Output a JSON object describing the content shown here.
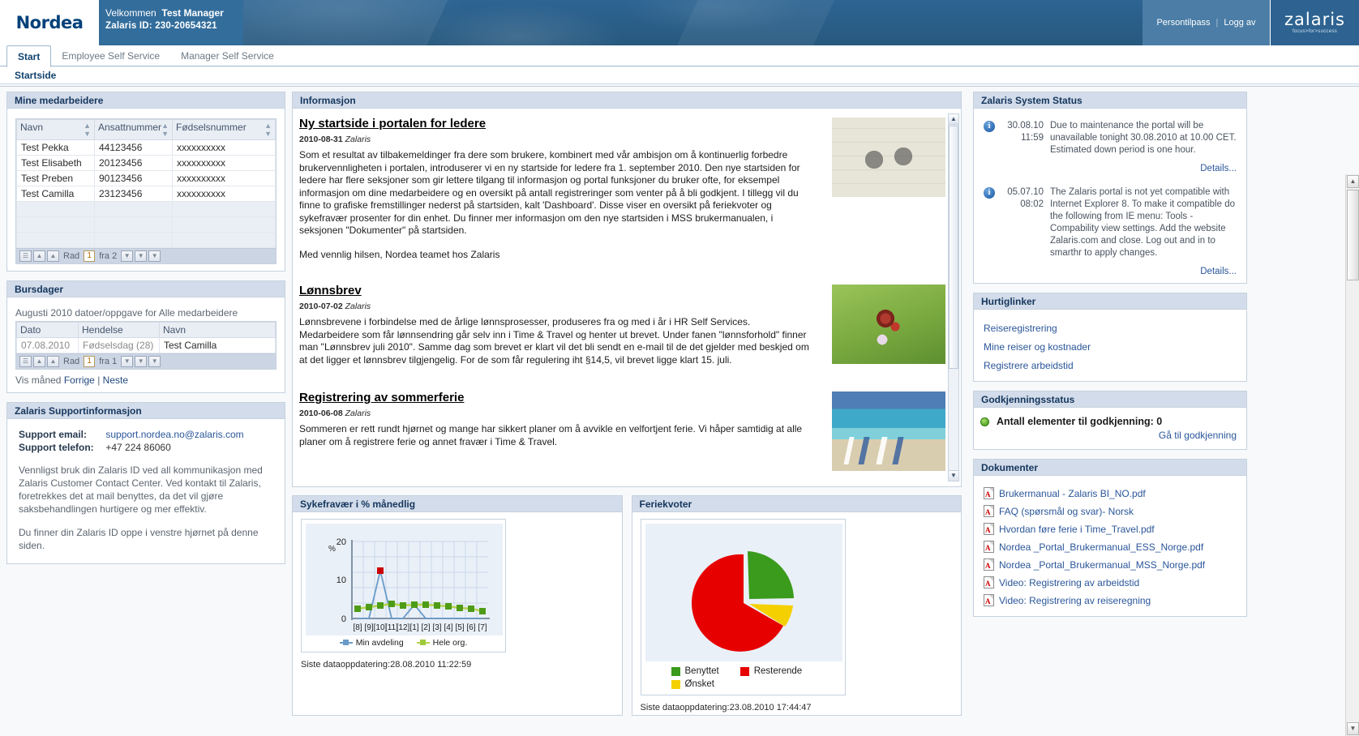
{
  "header": {
    "logo_text": "Nordea",
    "welcome_label": "Velkommen",
    "user_name": "Test Manager",
    "zalaris_id_line": "Zalaris ID: 230-20654321",
    "persontilpass": "Persontilpass",
    "separator": "|",
    "logg_av": "Logg av",
    "brand": "zalaris",
    "brand_tagline": "focus>for>success"
  },
  "tabs": [
    {
      "label": "Start",
      "active": true
    },
    {
      "label": "Employee Self Service",
      "active": false
    },
    {
      "label": "Manager Self Service",
      "active": false
    }
  ],
  "subtab": "Startside",
  "employees": {
    "title": "Mine medarbeidere",
    "columns": [
      "Navn",
      "Ansattnummer",
      "Fødselsnummer"
    ],
    "rows": [
      [
        "Test Pekka",
        "44123456",
        "xxxxxxxxxx"
      ],
      [
        "Test Elisabeth",
        "20123456",
        "xxxxxxxxxx"
      ],
      [
        "Test Preben",
        "90123456",
        "xxxxxxxxxx"
      ],
      [
        "Test Camilla",
        "23123456",
        "xxxxxxxxxx"
      ]
    ],
    "empty_rows": 3,
    "pager": {
      "label": "Rad",
      "current": "1",
      "of_label": "fra 2"
    }
  },
  "birthdays": {
    "title": "Bursdager",
    "caption": "Augusti 2010 datoer/oppgave for Alle medarbeidere",
    "columns": [
      "Dato",
      "Hendelse",
      "Navn"
    ],
    "rows": [
      [
        "07.08.2010",
        "Fødselsdag (28)",
        "Test Camilla"
      ]
    ],
    "pager": {
      "label": "Rad",
      "current": "1",
      "of_label": "fra 1"
    },
    "footer_label": "Vis måned",
    "prev": "Forrige",
    "sep": "|",
    "next": "Neste"
  },
  "support": {
    "title": "Zalaris Supportinformasjon",
    "email_label": "Support email:",
    "email_value": "support.nordea.no@zalaris.com",
    "phone_label": "Support telefon:",
    "phone_value": "+47 224 86060",
    "paragraph": "Vennligst bruk din Zalaris ID ved all kommunikasjon med Zalaris Customer Contact Center. Ved kontakt til Zalaris, foretrekkes det at mail benyttes, da det vil gjøre saksbehandlingen hurtigere og mer effektiv.",
    "paragraph2": "Du finner din Zalaris ID oppe i venstre hjørnet på denne siden."
  },
  "information": {
    "title": "Informasjon",
    "articles": [
      {
        "headline": "Ny startside i portalen for ledere",
        "date": "2010-08-31",
        "author": "Zalaris",
        "body": "Som et resultat av tilbakemeldinger fra dere som brukere, kombinert med vår ambisjon om å kontinuerlig forbedre brukervennligheten i portalen, introduserer vi en ny startside for ledere fra 1. september 2010. Den nye startsiden for ledere har flere seksjoner som gir lettere tilgang til informasjon og portal funksjoner du bruker ofte, for eksempel informasjon om dine medarbeidere og en oversikt på antall registreringer som venter på å bli godkjent. I tillegg vil du finne to grafiske fremstillinger nederst på startsiden, kalt 'Dashboard'. Disse viser en oversikt på feriekvoter og sykefravær prosenter for din enhet. Du finner mer informasjon om den nye startsiden i MSS brukermanualen, i seksjonen \"Dokumenter\" på startsiden.",
        "body2": "Med vennlig hilsen, Nordea teamet hos Zalaris",
        "image": "glasses-calendar-photo"
      },
      {
        "headline": "Lønnsbrev",
        "date": "2010-07-02",
        "author": "Zalaris",
        "body": "Lønnsbrevene i forbindelse med de årlige lønnsprosesser, produseres fra og med i år i HR Self Services. Medarbeidere som får lønnsendring går selv inn i Time & Travel og henter ut brevet. Under fanen \"lønnsforhold\" finner man \"Lønnsbrev juli 2010\". Samme dag som brevet er klart vil det bli sendt en e-mail til de det gjelder med beskjed om at det ligger et lønnsbrev tilgjengelig. For de som får regulering iht §14,5, vil brevet ligge klart 15. juli.",
        "body2": "",
        "image": "butterfly-flower-photo"
      },
      {
        "headline": "Registrering av sommerferie",
        "date": "2010-06-08",
        "author": "Zalaris",
        "body": "Sommeren er rett rundt hjørnet og mange har sikkert planer om å avvikle en velfortjent ferie. Vi håper samtidig at alle planer om å registrere ferie og annet fravær i Time & Travel.",
        "body2": "",
        "image": "beach-chairs-photo"
      }
    ]
  },
  "sick_panel": {
    "title": "Sykefravær i % månedlig",
    "footer": "Siste dataoppdatering:28.08.2010 11:22:59"
  },
  "vacation_panel": {
    "title": "Feriekvoter",
    "footer": "Siste dataoppdatering:23.08.2010 17:44:47"
  },
  "system_status": {
    "title": "Zalaris System Status",
    "items": [
      {
        "icon": "info-icon",
        "date": "30.08.10",
        "time": "11:59",
        "text": "Due to maintenance the portal will be unavailable tonight 30.08.2010 at 10.00 CET. Estimated down period is one hour.",
        "details": "Details..."
      },
      {
        "icon": "info-icon",
        "date": "05.07.10",
        "time": "08:02",
        "text": "The Zalaris portal is not yet compatible with Internet Explorer 8. To make it compatible do the following from IE menu: Tools - Compability view settings. Add the website Zalaris.com and close. Log out and in to smarthr to apply changes.",
        "details": "Details..."
      }
    ]
  },
  "quicklinks": {
    "title": "Hurtiglinker",
    "items": [
      "Reiseregistrering",
      "Mine reiser og kostnader",
      "Registrere arbeidstid"
    ]
  },
  "approval": {
    "title": "Godkjenningsstatus",
    "status_text": "Antall elementer til godkjenning: 0",
    "link": "Gå til godkjenning",
    "status_color": "#4e9b17"
  },
  "documents": {
    "title": "Dokumenter",
    "items": [
      {
        "icon": "pdf-icon",
        "label": "Brukermanual - Zalaris BI_NO.pdf"
      },
      {
        "icon": "pdf-icon",
        "label": "FAQ (spørsmål og svar)- Norsk"
      },
      {
        "icon": "pdf-icon",
        "label": "Hvordan føre ferie i Time_Travel.pdf"
      },
      {
        "icon": "pdf-icon",
        "label": "Nordea _Portal_Brukermanual_ESS_Norge.pdf"
      },
      {
        "icon": "pdf-icon",
        "label": "Nordea _Portal_Brukermanual_MSS_Norge.pdf"
      },
      {
        "icon": "pdf-icon",
        "label": "Video: Registrering av arbeidstid"
      },
      {
        "icon": "pdf-icon",
        "label": "Video: Registrering av reiseregning"
      }
    ]
  },
  "chart_data": [
    {
      "type": "line",
      "title": "Sykefravær i % månedlig",
      "xlabel": "",
      "ylabel": "%",
      "ylim": [
        0,
        20
      ],
      "yticks": [
        0,
        10,
        20
      ],
      "grid": true,
      "legend_position": "bottom",
      "categories": [
        "[8]",
        "[9]",
        "[10]",
        "[11]",
        "[12]",
        "[1]",
        "[2]",
        "[3]",
        "[4]",
        "[5]",
        "[6]",
        "[7]"
      ],
      "series": [
        {
          "name": "Min avdeling",
          "color": "#6b9bc8",
          "marker_color": "#cc0000",
          "values": [
            0,
            0,
            12.3,
            0,
            0,
            3.6,
            0,
            0,
            0,
            0,
            0,
            0
          ]
        },
        {
          "name": "Hele org.",
          "color": "#b6d44a",
          "marker_color": "#4e9b17",
          "values": [
            2.5,
            3.0,
            3.3,
            3.9,
            3.3,
            3.6,
            3.7,
            3.4,
            3.2,
            2.9,
            2.7,
            2.1
          ]
        }
      ]
    },
    {
      "type": "pie",
      "title": "Feriekvoter",
      "legend_position": "bottom",
      "labels": [
        "Benyttet",
        "Resterende",
        "Ønsket"
      ],
      "colors": [
        "#3a9b1c",
        "#e60000",
        "#f5d000"
      ],
      "values": [
        27,
        66,
        7
      ]
    }
  ]
}
